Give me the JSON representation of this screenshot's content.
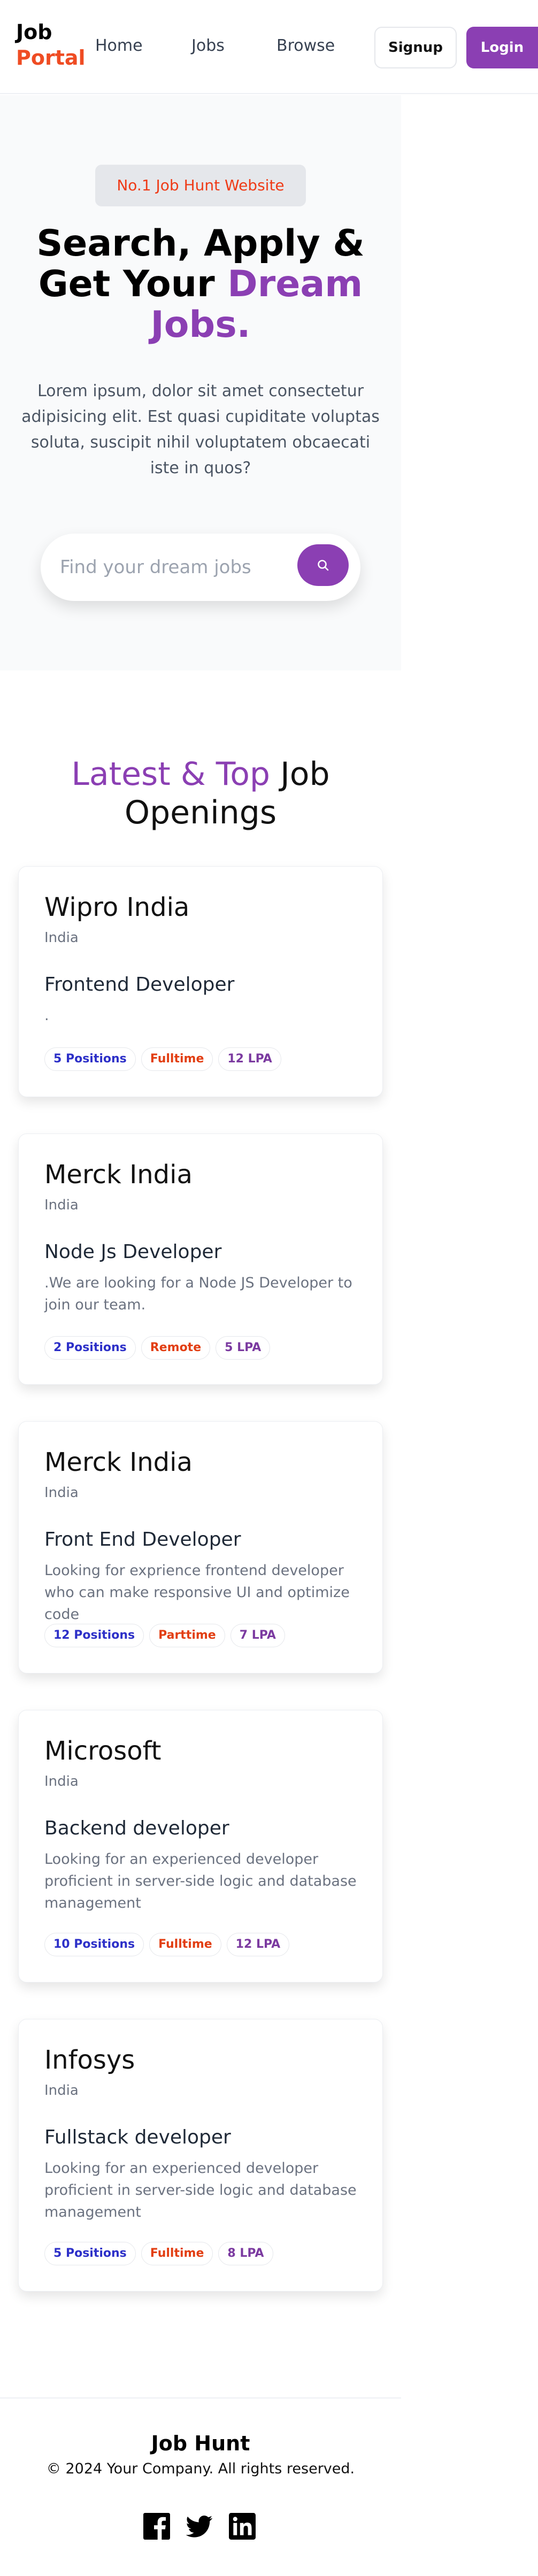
{
  "nav": {
    "logo_line1": "Job",
    "logo_line2": "Portal",
    "links": [
      "Home",
      "Jobs",
      "Browse"
    ],
    "signup_label": "Signup",
    "login_label": "Login"
  },
  "hero": {
    "badge": "No.1 Job Hunt Website",
    "title_part1": "Search, Apply & Get Your ",
    "title_accent": "Dream Jobs.",
    "description": "Lorem ipsum, dolor sit amet consectetur adipisicing elit. Est quasi cupiditate voluptas soluta, suscipit nihil voluptatem obcaecati iste in quos?",
    "search_placeholder": "Find your dream jobs",
    "search_icon": "search-icon"
  },
  "jobs": {
    "title_accent": "Latest & Top",
    "title_rest": " Job Openings",
    "cards": [
      {
        "company": "Wipro India",
        "location": "India",
        "role": "Frontend Developer",
        "description": ".",
        "positions": "5 Positions",
        "type": "Fulltime",
        "salary": "12 LPA"
      },
      {
        "company": "Merck India",
        "location": "India",
        "role": "Node Js Developer",
        "description": ".We are looking for a Node JS Developer to join our team.",
        "positions": "2 Positions",
        "type": "Remote",
        "salary": "5 LPA"
      },
      {
        "company": "Merck India",
        "location": "India",
        "role": "Front End Developer",
        "description": "Looking for exprience frontend developer who can make responsive UI and optimize code",
        "positions": "12 Positions",
        "type": "Parttime",
        "salary": "7 LPA"
      },
      {
        "company": "Microsoft",
        "location": "India",
        "role": "Backend developer",
        "description": "Looking for an experienced developer proficient in server-side logic and database management",
        "positions": "10 Positions",
        "type": "Fulltime",
        "salary": "12 LPA"
      },
      {
        "company": "Infosys",
        "location": "India",
        "role": "Fullstack developer",
        "description": "Looking for an experienced developer proficient in server-side logic and database management",
        "positions": "5 Positions",
        "type": "Fulltime",
        "salary": "8 LPA"
      }
    ]
  },
  "footer": {
    "brand": "Job Hunt",
    "copyright": "© 2024 Your Company. All rights reserved.",
    "social_icons": [
      "facebook-icon",
      "twitter-icon",
      "linkedin-icon"
    ]
  },
  "colors": {
    "accent": "#8b3fb3",
    "brand_red": "#ef4c23",
    "positions_blue": "#2d30c8",
    "type_red": "#e23e12"
  }
}
